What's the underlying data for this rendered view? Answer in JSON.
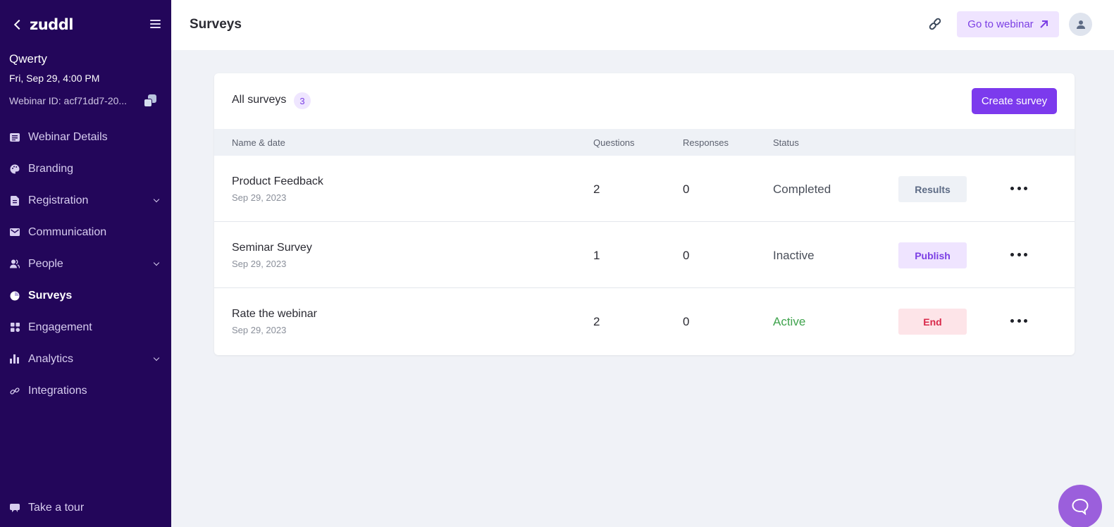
{
  "sidebar": {
    "logo": "zuddl",
    "event_name": "Qwerty",
    "event_datetime": "Fri, Sep 29, 4:00 PM",
    "webinar_id": "Webinar ID: acf71dd7-20...",
    "items": [
      {
        "label": "Webinar Details",
        "icon": "document-list-icon",
        "has_chevron": false,
        "active": false
      },
      {
        "label": "Branding",
        "icon": "palette-icon",
        "has_chevron": false,
        "active": false
      },
      {
        "label": "Registration",
        "icon": "file-icon",
        "has_chevron": true,
        "active": false
      },
      {
        "label": "Communication",
        "icon": "mail-icon",
        "has_chevron": false,
        "active": false
      },
      {
        "label": "People",
        "icon": "people-icon",
        "has_chevron": true,
        "active": false
      },
      {
        "label": "Surveys",
        "icon": "pie-chart-icon",
        "has_chevron": false,
        "active": true
      },
      {
        "label": "Engagement",
        "icon": "grid-icon",
        "has_chevron": false,
        "active": false
      },
      {
        "label": "Analytics",
        "icon": "bar-chart-icon",
        "has_chevron": true,
        "active": false
      },
      {
        "label": "Integrations",
        "icon": "link-icon",
        "has_chevron": false,
        "active": false
      }
    ],
    "tour_label": "Take a tour"
  },
  "header": {
    "title": "Surveys",
    "goto_label": "Go to webinar"
  },
  "surveys": {
    "title": "All surveys",
    "count": "3",
    "create_label": "Create survey",
    "columns": {
      "name": "Name & date",
      "questions": "Questions",
      "responses": "Responses",
      "status": "Status"
    },
    "rows": [
      {
        "name": "Product Feedback",
        "date": "Sep 29, 2023",
        "questions": "2",
        "responses": "0",
        "status": "Completed",
        "action": "Results"
      },
      {
        "name": "Seminar Survey",
        "date": "Sep 29, 2023",
        "questions": "1",
        "responses": "0",
        "status": "Inactive",
        "action": "Publish"
      },
      {
        "name": "Rate the webinar",
        "date": "Sep 29, 2023",
        "questions": "2",
        "responses": "0",
        "status": "Active",
        "action": "End"
      }
    ]
  },
  "colors": {
    "sidebar_bg": "#23065a",
    "accent": "#7c3aed",
    "status_active": "#3fa34d",
    "results_bg": "#eef1f6",
    "results_fg": "#5d6b85",
    "publish_bg": "#efe4ff",
    "publish_fg": "#7b3fe4",
    "end_bg": "#fde4e8",
    "end_fg": "#d9294a"
  }
}
